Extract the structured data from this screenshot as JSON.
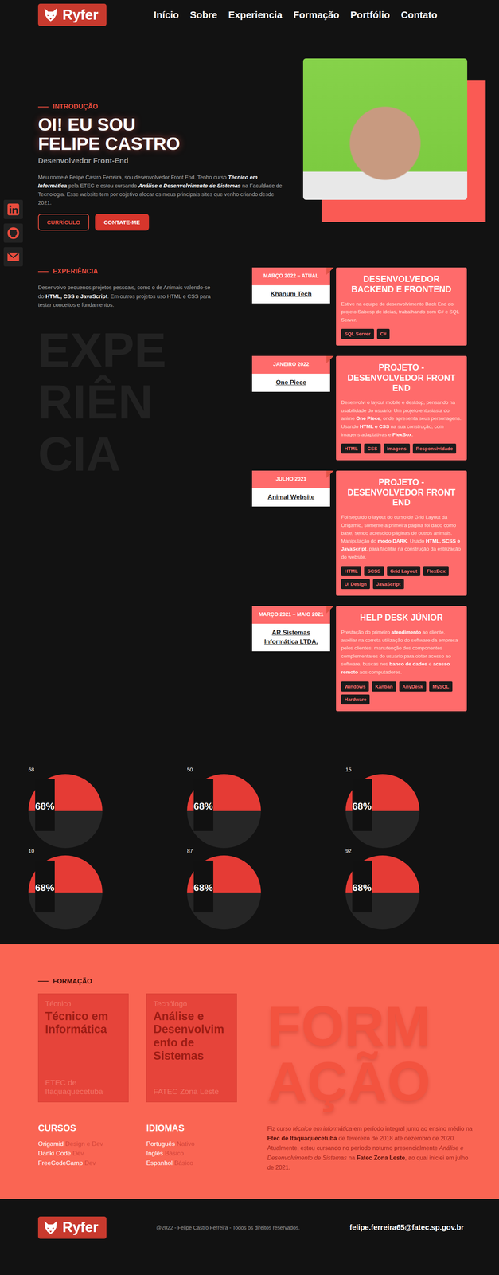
{
  "logo": {
    "text": "Ryfer"
  },
  "nav": [
    "Início",
    "Sobre",
    "Experiencia",
    "Formação",
    "Portfólio",
    "Contato"
  ],
  "hero": {
    "eyebrow": "INTRODUÇÃO",
    "title_lines": [
      "OI! EU SOU",
      "FELIPE CASTRO"
    ],
    "subtitle": "Desenvolvedor Front-End",
    "paragraph": [
      {
        "text": "Meu nome é Felipe Castro Ferreira, sou desenvolvedor Front End. Tenho curso ",
        "kind": "plain"
      },
      {
        "text": "Técnico em Informática",
        "kind": "strong-em"
      },
      {
        "text": " pela ETEC e estou cursando ",
        "kind": "plain"
      },
      {
        "text": "Análise e Desenvolvimento de Sistemas",
        "kind": "strong-em"
      },
      {
        "text": " na Faculdade de Tecnologia. Esse website tem por objetivo alocar os meus principais sites que venho criando desde 2021.",
        "kind": "plain"
      }
    ],
    "buttons": [
      {
        "label": "CURRÍCULO",
        "kind": "outline"
      },
      {
        "label": "CONTATE-ME",
        "kind": "filled"
      }
    ]
  },
  "experience": {
    "eyebrow": "EXPERIÊNCIA",
    "paragraph": [
      {
        "text": "Desenvolvo pequenos projetos pessoais, como o de Animais valendo-se do ",
        "kind": "plain"
      },
      {
        "text": "HTML, CSS e JavaScript",
        "kind": "strong"
      },
      {
        "text": ". Em outros projetos uso HTML e CSS para testar conceitos e fundamentos.",
        "kind": "plain"
      }
    ],
    "watermark_lines": [
      "EXPE",
      "RIÊN",
      "CIA"
    ],
    "items": [
      {
        "date": "MARÇO 2022 – ATUAL",
        "company": "Khanum Tech",
        "title": "DESENVOLVEDOR BACKEND E FRONTEND",
        "description": [
          {
            "text": "Estive na equipe de desenvolvimento Back End do projeto Sabesp de ideias, trabalhando com C# e SQL Server.",
            "kind": "plain"
          }
        ],
        "tags": [
          "SQL Server",
          "C#"
        ]
      },
      {
        "date": "JANEIRO 2022",
        "company": "One Piece",
        "title": "PROJETO - DESENVOLVEDOR FRONT END",
        "description": [
          {
            "text": "Desenvolvi o layout mobile e desktop, pensando na usabilidade do usuário. Um projeto entusiasta do anime ",
            "kind": "plain"
          },
          {
            "text": "One Piece",
            "kind": "strong"
          },
          {
            "text": ", onde apresenta seus personagens. Usando ",
            "kind": "plain"
          },
          {
            "text": "HTML e CSS",
            "kind": "strong"
          },
          {
            "text": " na sua construção, com imagens adaptativas e ",
            "kind": "plain"
          },
          {
            "text": "FlexBox",
            "kind": "strong"
          },
          {
            "text": ".",
            "kind": "plain"
          }
        ],
        "tags": [
          "HTML",
          "CSS",
          "Imagens",
          "Responsividade"
        ]
      },
      {
        "date": "JULHO 2021",
        "company": "Animal Website",
        "title": "PROJETO - DESENVOLVEDOR FRONT END",
        "description": [
          {
            "text": "Foi seguido o layout do curso de Grid Layout da Origamid, somente a primeira página foi dado como base, sendo acrescido páginas de outros animais. Manipulação do ",
            "kind": "plain"
          },
          {
            "text": "modo DARK",
            "kind": "strong"
          },
          {
            "text": ". Usado ",
            "kind": "plain"
          },
          {
            "text": "HTML, SCSS e JavaScript",
            "kind": "strong"
          },
          {
            "text": ", para facilitar na construção da estilização do website.",
            "kind": "plain"
          }
        ],
        "tags": [
          "HTML",
          "SCSS",
          "Grid Layout",
          "FlexBox",
          "UI Design",
          "JavaScript"
        ]
      },
      {
        "date": "MARÇO 2021 – MAIO 2021",
        "company": "AR Sistemas Informática LTDA.",
        "title": "HELP DESK JÚNIOR",
        "description": [
          {
            "text": "Prestação do primeiro ",
            "kind": "plain"
          },
          {
            "text": "atendimento",
            "kind": "strong"
          },
          {
            "text": " ao cliente, auxiliar na correta utilização do software da empresa pelos clientes, manutenção dos componentes complementares do usuário para obter acesso ao software, buscas nos ",
            "kind": "plain"
          },
          {
            "text": "banco de dados",
            "kind": "strong"
          },
          {
            "text": " e ",
            "kind": "plain"
          },
          {
            "text": "acesso remoto",
            "kind": "strong"
          },
          {
            "text": " aos computadores.",
            "kind": "plain"
          }
        ],
        "tags": [
          "Windows",
          "Kanban",
          "AnyDesk",
          "MySQL",
          "Hardware"
        ]
      }
    ]
  },
  "skills": [
    {
      "label": "68",
      "percent": "68%",
      "level": 0.5
    },
    {
      "label": "50",
      "percent": "68%",
      "level": 0.5
    },
    {
      "label": "15",
      "percent": "68%",
      "level": 0.5
    },
    {
      "label": "10",
      "percent": "68%",
      "level": 0.5
    },
    {
      "label": "87",
      "percent": "68%",
      "level": 0.5
    },
    {
      "label": "92",
      "percent": "68%",
      "level": 0.5
    }
  ],
  "education": {
    "eyebrow": "FORMAÇÃO",
    "cards": [
      {
        "kind_label": "Técnico",
        "title": "Técnico em Informática",
        "school": "ETEC de Itaquaquecetuba"
      },
      {
        "kind_label": "Tecnólogo",
        "title": "Análise e Desenvolvimento de Sistemas",
        "school": "FATEC Zona Leste"
      }
    ],
    "lists": [
      {
        "title": "CURSOS",
        "items": [
          {
            "name": "Origamid",
            "detail": "Design e Dev"
          },
          {
            "name": "Danki Code",
            "detail": "Dev"
          },
          {
            "name": "FreeCodeCamp",
            "detail": "Dev"
          }
        ]
      },
      {
        "title": "IDIOMAS",
        "items": [
          {
            "name": "Português",
            "detail": "Nativo"
          },
          {
            "name": "Inglês",
            "detail": "Básico"
          },
          {
            "name": "Espanhol",
            "detail": "Básico"
          }
        ]
      }
    ],
    "watermark_lines": [
      "FORM",
      "AÇÃO"
    ],
    "paragraph": [
      {
        "text": "Fiz curso ",
        "kind": "plain"
      },
      {
        "text": "técnico em informática",
        "kind": "em"
      },
      {
        "text": " em período integral junto ao ensino médio na ",
        "kind": "plain"
      },
      {
        "text": "Etec de Itaquaquecetuba",
        "kind": "strong"
      },
      {
        "text": " de fevereiro de 2018 até dezembro de 2020. Atualmente, estou cursando no período noturno presencialmente ",
        "kind": "plain"
      },
      {
        "text": "Análise e Desenvolvimento de Sistemas",
        "kind": "em"
      },
      {
        "text": " na ",
        "kind": "plain"
      },
      {
        "text": "Fatec Zona Leste",
        "kind": "strong"
      },
      {
        "text": ", ao qual iniciei em julho de 2021.",
        "kind": "plain"
      }
    ]
  },
  "footer": {
    "logo_text": "Ryfer",
    "copyright": "@2022 - Felipe Castro Ferreira - Todos os direitos reservados.",
    "email": "felipe.ferreira65@fatec.sp.gov.br"
  }
}
